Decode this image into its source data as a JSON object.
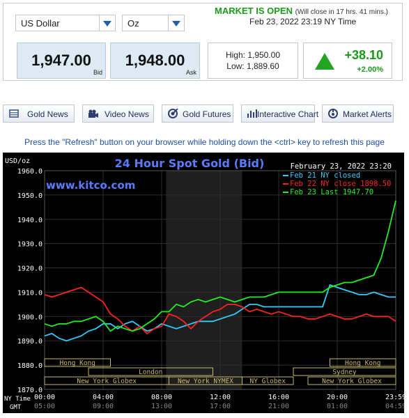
{
  "selectors": {
    "currency": "US Dollar",
    "unit": "Oz"
  },
  "market": {
    "status": "MARKET IS OPEN",
    "close_note": "(Will close in 17 hrs. 41 mins.)",
    "timestamp": "Feb 23, 2022 23:19 NY Time"
  },
  "quote": {
    "bid": "1,947.00",
    "bid_label": "Bid",
    "ask": "1,948.00",
    "ask_label": "Ask",
    "high": "High: 1,950.00",
    "low": "Low: 1,889.60",
    "change": "+38.10",
    "change_pct": "+2.00%"
  },
  "nav": [
    {
      "label": "Gold News",
      "icon": "news-icon"
    },
    {
      "label": "Video News",
      "icon": "video-camera-icon"
    },
    {
      "label": "Gold Futures",
      "icon": "futures-icon"
    },
    {
      "label": "Interactive Chart",
      "icon": "bar-chart-icon"
    },
    {
      "label": "Market Alerts",
      "icon": "alert-icon"
    }
  ],
  "refresh_note": "Press the \"Refresh\" button on your browser while holding down the <ctrl> key to refresh this page",
  "colors": {
    "chart_bg": "#000000",
    "grid": "#2e2e2e",
    "title": "#5b7cff",
    "feb21": "#33ccff",
    "feb22": "#ff2222",
    "feb23": "#22ee22",
    "session_box": "#c9b86a",
    "accent_green": "#1a9a1a",
    "link_blue": "#1f4fa0"
  },
  "chart_data": {
    "type": "line",
    "title": "24 Hour Spot Gold (Bid)",
    "unit_label": "USD/oz",
    "date_label": "February 23, 2022 23:20",
    "watermark": "www.kitco.com",
    "ylim": [
      1870,
      1960
    ],
    "yticks": [
      "1960.0",
      "1950.0",
      "1940.0",
      "1930.0",
      "1920.0",
      "1910.0",
      "1900.0",
      "1890.0",
      "1880.0",
      "1870.0"
    ],
    "xlim": [
      0,
      24
    ],
    "xticks_ny": [
      "00:00",
      "04:00",
      "08:00",
      "12:00",
      "16:00",
      "20:00",
      "23:59"
    ],
    "xticks_gmt": [
      "05:00",
      "09:00",
      "13:00",
      "17:00",
      "21:00",
      "01:00",
      "04:59"
    ],
    "row_label_ny": "NY Time",
    "row_label_gmt": "GMT",
    "legend_position": "top-right",
    "sessions": [
      {
        "name": "Hong Kong",
        "row": 0,
        "start": 0,
        "end": 4.5
      },
      {
        "name": "Hong Kong",
        "row": 0,
        "start": 19.5,
        "end": 24
      },
      {
        "name": "London",
        "row": 1,
        "start": 3,
        "end": 11.5
      },
      {
        "name": "Sydney",
        "row": 1,
        "start": 17,
        "end": 24
      },
      {
        "name": "New York Globex",
        "row": 2,
        "start": 0,
        "end": 8.5
      },
      {
        "name": "New York NYMEX",
        "row": 2,
        "start": 8.5,
        "end": 13.5
      },
      {
        "name": "NY Globex",
        "row": 2,
        "start": 13.5,
        "end": 17
      },
      {
        "name": "New York Globex",
        "row": 2,
        "start": 18,
        "end": 24
      }
    ],
    "shaded_region": [
      8.3,
      13.5
    ],
    "series": [
      {
        "name": "Feb 21 NY closed",
        "x": [
          0,
          0.5,
          1,
          1.5,
          2,
          2.5,
          3,
          3.5,
          4,
          4.5,
          5,
          5.5,
          6,
          6.5,
          7,
          7.5,
          8,
          8.5,
          9,
          9.5,
          10,
          10.5,
          11,
          11.5,
          12,
          12.5,
          13,
          13.5,
          14,
          14.5,
          15,
          15.5,
          16,
          16.5,
          17,
          17.5,
          18,
          18.5,
          19,
          19.5,
          20,
          20.5,
          21,
          21.5,
          22,
          22.5,
          23,
          23.5,
          24
        ],
        "y": [
          1892,
          1893,
          1891,
          1890,
          1891,
          1892,
          1894,
          1895,
          1897,
          1897,
          1895,
          1897,
          1898,
          1896,
          1894,
          1895,
          1897,
          1896,
          1895,
          1896,
          1897,
          1898,
          1898,
          1898,
          1899,
          1900,
          1901,
          1903,
          1905,
          1905,
          1904,
          1904,
          1904,
          1904,
          1904,
          1904,
          1904,
          1904,
          1904,
          1913,
          1912,
          1911,
          1910,
          1909,
          1909,
          1910,
          1909,
          1908,
          1908
        ]
      },
      {
        "name": "Feb 22 NY close 1898.50",
        "x": [
          0,
          0.5,
          1,
          1.5,
          2,
          2.5,
          3,
          3.5,
          4,
          4.5,
          5,
          5.5,
          6,
          6.5,
          7,
          7.5,
          8,
          8.5,
          9,
          9.5,
          10,
          10.5,
          11,
          11.5,
          12,
          12.5,
          13,
          13.5,
          14,
          14.5,
          15,
          15.5,
          16,
          16.5,
          17,
          17.5,
          18,
          18.5,
          19,
          19.5,
          20,
          20.5,
          21,
          21.5,
          22,
          22.5,
          23,
          23.5,
          24
        ],
        "y": [
          1909,
          1908,
          1909,
          1910,
          1911,
          1912,
          1910,
          1908,
          1906,
          1901,
          1899,
          1896,
          1894,
          1896,
          1893,
          1895,
          1896,
          1901,
          1900,
          1898,
          1895,
          1898,
          1900,
          1902,
          1903,
          1905,
          1905,
          1904,
          1902,
          1903,
          1902,
          1901,
          1902,
          1901,
          1900,
          1900,
          1899,
          1899,
          1900,
          1901,
          1900,
          1899,
          1899,
          1900,
          1901,
          1900,
          1900,
          1900,
          1898
        ]
      },
      {
        "name": "Feb 23 Last 1947.70",
        "x": [
          0,
          0.5,
          1,
          1.5,
          2,
          2.5,
          3,
          3.5,
          4,
          4.5,
          5,
          5.5,
          6,
          6.5,
          7,
          7.5,
          8,
          8.5,
          9,
          9.5,
          10,
          10.5,
          11,
          11.5,
          12,
          12.5,
          13,
          13.5,
          14,
          14.5,
          15,
          15.5,
          16,
          16.5,
          17,
          17.5,
          18,
          18.5,
          19,
          19.5,
          20,
          20.5,
          21,
          21.5,
          22,
          22.5,
          23,
          23.5,
          24
        ],
        "y": [
          1897,
          1896,
          1897,
          1897,
          1898,
          1898,
          1899,
          1900,
          1898,
          1894,
          1896,
          1895,
          1894,
          1895,
          1897,
          1899,
          1902,
          1902,
          1905,
          1904,
          1906,
          1907,
          1906,
          1907,
          1908,
          1907,
          1906,
          1907,
          1908,
          1908,
          1908,
          1909,
          1910,
          1910,
          1910,
          1910,
          1910,
          1910,
          1910,
          1912,
          1913,
          1914,
          1914,
          1915,
          1916,
          1917,
          1924,
          1935,
          1947.7
        ]
      }
    ]
  }
}
